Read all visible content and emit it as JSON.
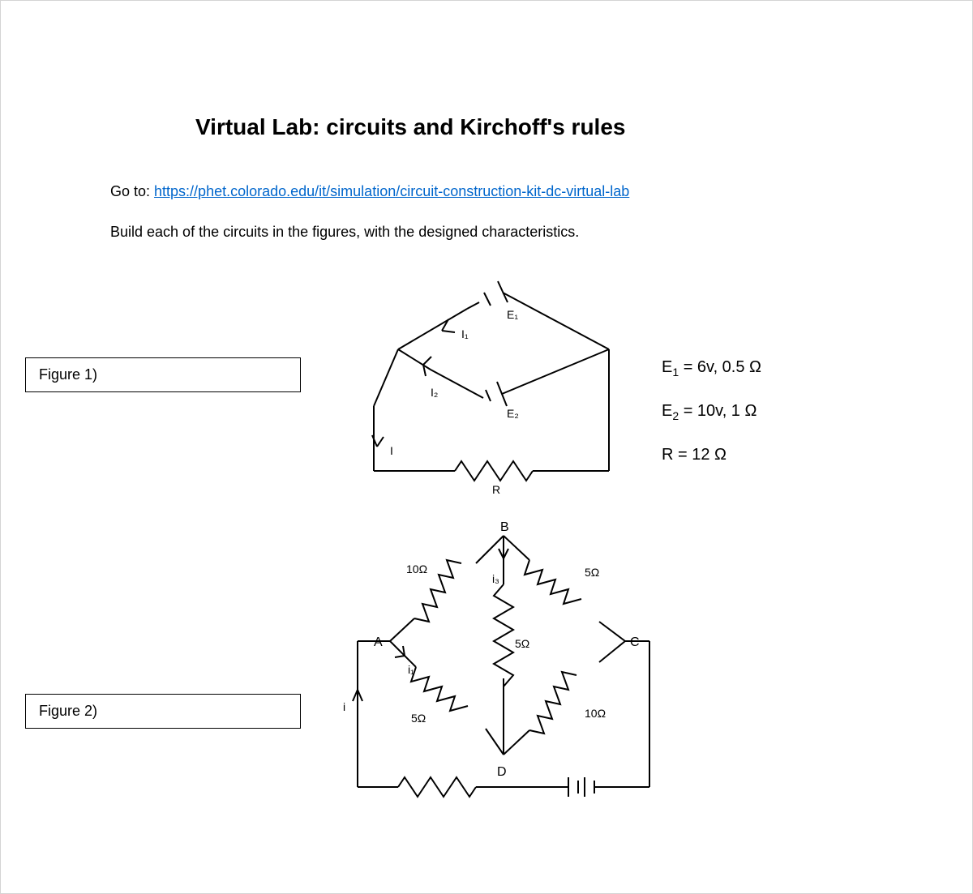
{
  "title": "Virtual Lab: circuits and Kirchoff's rules",
  "intro": {
    "line1_prefix": "Go to: ",
    "link_text": "https://phet.colorado.edu/it/simulation/circuit-construction-kit-dc-virtual-lab",
    "line2": "Build each of the circuits in the figures, with the designed characteristics."
  },
  "figure1": {
    "label": "Figure 1)",
    "labels": {
      "E1": "E₁",
      "E2": "E₂",
      "I1": "I₁",
      "I2": "I₂",
      "I": "I",
      "R": "R"
    },
    "legend": {
      "E1": "E₁ = 6v, 0.5 Ω",
      "E2": "E₂ = 10v, 1 Ω",
      "R": "R = 12 Ω"
    }
  },
  "figure2": {
    "label": "Figure 2)",
    "labels": {
      "A": "A",
      "B": "B",
      "C": "C",
      "D": "D",
      "i": "i",
      "i1": "i₁",
      "i3": "i₃",
      "R_AB": "10Ω",
      "R_BC": "5Ω",
      "R_AD": "5Ω",
      "R_DC": "10Ω",
      "R_BD": "5Ω"
    }
  }
}
